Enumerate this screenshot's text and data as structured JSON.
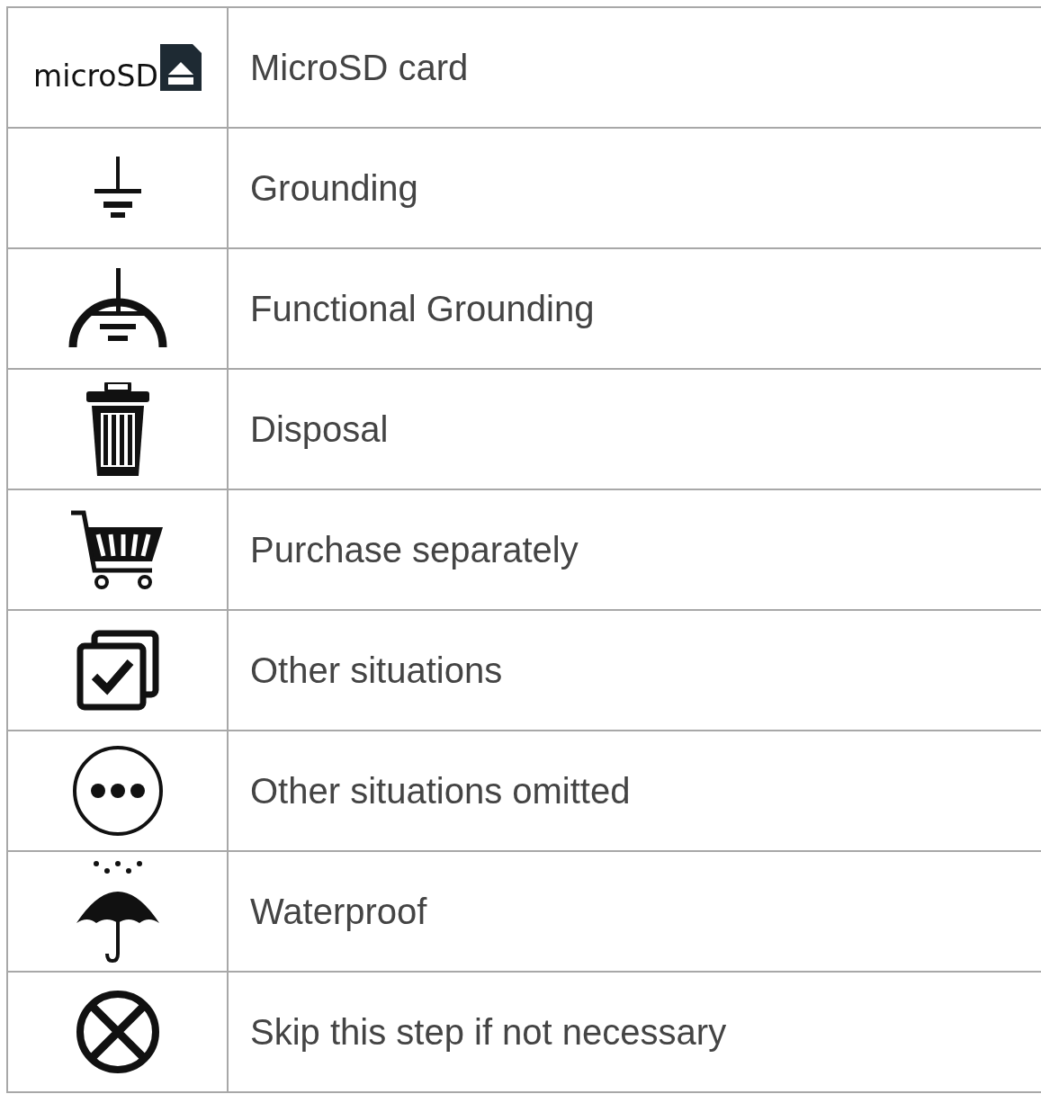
{
  "symbols": [
    {
      "kind": "microsd",
      "icon_text": "microSD",
      "label": "MicroSD card"
    },
    {
      "kind": "grounding",
      "label": "Grounding"
    },
    {
      "kind": "functional-grounding",
      "label": "Functional Grounding"
    },
    {
      "kind": "disposal",
      "label": "Disposal"
    },
    {
      "kind": "cart",
      "label": "Purchase separately"
    },
    {
      "kind": "checkbox",
      "label": "Other situations"
    },
    {
      "kind": "ellipsis",
      "label": "Other situations omitted"
    },
    {
      "kind": "umbrella",
      "label": "Waterproof"
    },
    {
      "kind": "cross",
      "label": "Skip this step if not necessary"
    }
  ]
}
